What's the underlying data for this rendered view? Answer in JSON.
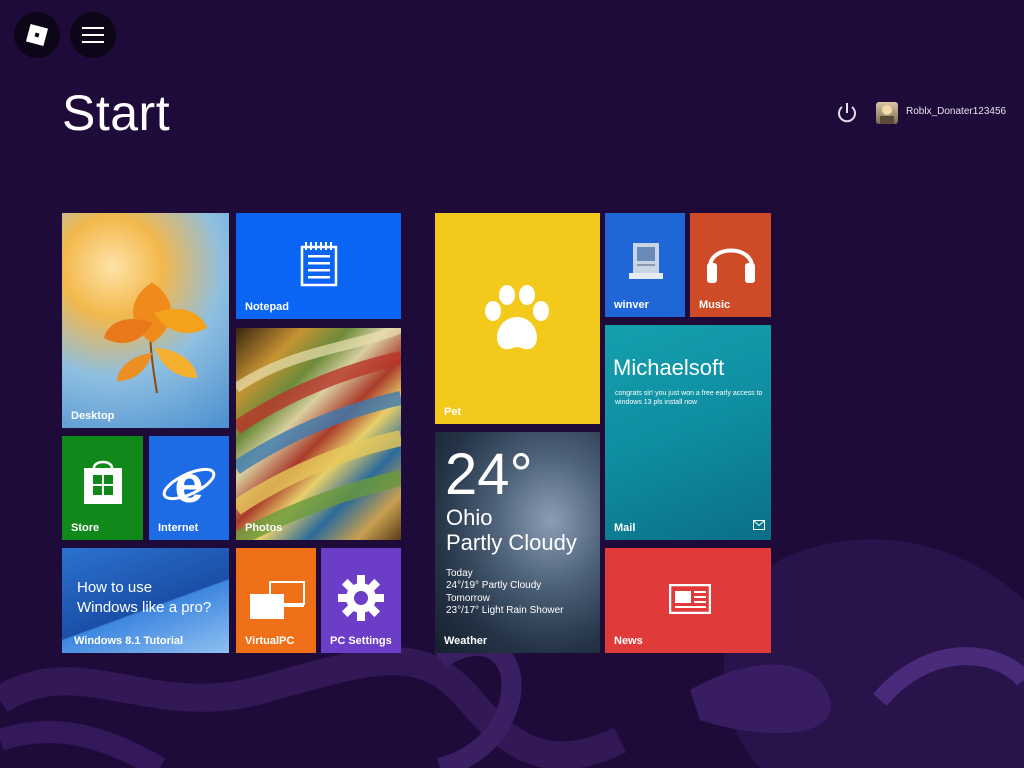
{
  "header": {
    "title": "Start",
    "username": "Roblx_Donater123456"
  },
  "icons": {
    "roblox": "roblox-logo-icon",
    "menu": "hamburger-menu-icon",
    "power": "power-icon",
    "avatar": "user-avatar"
  },
  "tiles": {
    "desktop": {
      "label": "Desktop",
      "color": "#4a8ed0"
    },
    "notepad": {
      "label": "Notepad",
      "color": "#0a65f5"
    },
    "photos": {
      "label": "Photos"
    },
    "store": {
      "label": "Store",
      "color": "#11891a"
    },
    "internet": {
      "label": "Internet",
      "color": "#1e6be6"
    },
    "tutorial": {
      "label": "Windows 8.1 Tutorial",
      "line1": "How to use",
      "line2": "Windows like a pro?"
    },
    "virtualpc": {
      "label": "VirtualPC",
      "color": "#f0701a"
    },
    "pcsettings": {
      "label": "PC Settings",
      "color": "#6c3ec8"
    },
    "pet": {
      "label": "Pet",
      "color": "#f3c91b"
    },
    "weather": {
      "label": "Weather",
      "temperature": "24°",
      "city": "Ohio",
      "condition": "Partly Cloudy",
      "today_label": "Today",
      "today_forecast": "24°/19° Partly Cloudy",
      "tomorrow_label": "Tomorrow",
      "tomorrow_forecast": "23°/17° Light Rain Shower"
    },
    "winver": {
      "label": "winver",
      "color": "#1f67d6"
    },
    "music": {
      "label": "Music",
      "color": "#cf4b28"
    },
    "mail": {
      "label": "Mail",
      "title": "Michaelsoft",
      "message": "congrats sir! you just won a free early access to windows 13 pls install now"
    },
    "news": {
      "label": "News",
      "color": "#e03a3a"
    }
  }
}
